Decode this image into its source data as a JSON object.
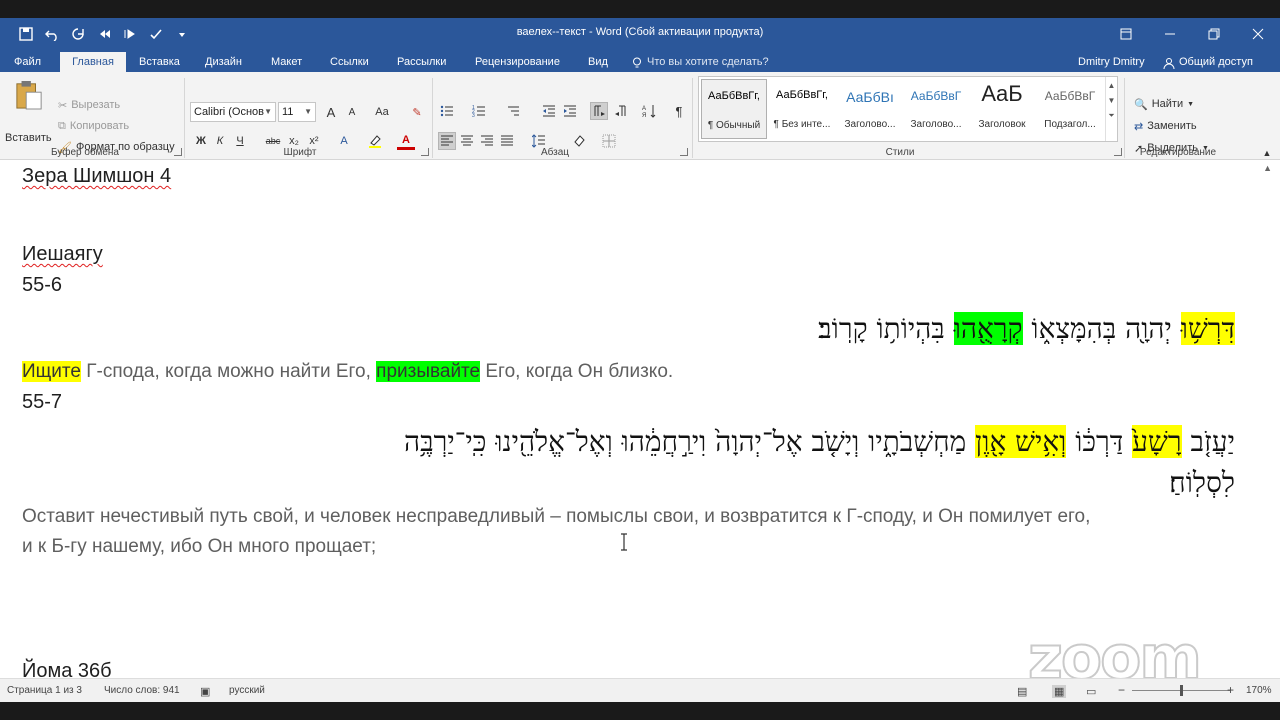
{
  "window": {
    "title": "ваелех--текст - Word (Сбой активации продукта)"
  },
  "tabs": {
    "file": "Файл",
    "items": [
      "Главная",
      "Вставка",
      "Дизайн",
      "Макет",
      "Ссылки",
      "Рассылки",
      "Рецензирование",
      "Вид"
    ],
    "tell_me": "Что вы хотите сделать?",
    "user": "Dmitry Dmitry",
    "share": "Общий доступ"
  },
  "clipboard": {
    "paste": "Вставить",
    "cut": "Вырезать",
    "copy": "Копировать",
    "format_painter": "Формат по образцу",
    "group": "Буфер обмена"
  },
  "font": {
    "name": "Calibri (Основ",
    "size": "11",
    "group": "Шрифт",
    "bold": "Ж",
    "italic": "К",
    "underline": "Ч",
    "strike": "abc",
    "sub": "x₂",
    "sup": "x²",
    "case": "Aa",
    "grow": "A",
    "shrink": "A",
    "effects": "A",
    "color": "A"
  },
  "paragraph": {
    "group": "Абзац"
  },
  "styles": {
    "group": "Стили",
    "items": [
      {
        "sample": "АаБбВвГг,",
        "name": "¶ Обычный"
      },
      {
        "sample": "АаБбВвГг,",
        "name": "¶ Без инте..."
      },
      {
        "sample": "АаБбВı",
        "name": "Заголово..."
      },
      {
        "sample": "АаБбВвГ",
        "name": "Заголово..."
      },
      {
        "sample": "AaБ",
        "name": "Заголовок"
      },
      {
        "sample": "АаБбВвГ",
        "name": "Подзагол..."
      }
    ]
  },
  "editing": {
    "group": "Редактирование",
    "find": "Найти",
    "replace": "Заменить",
    "select": "Выделить"
  },
  "document": {
    "line1": "Зера Шимшон 4",
    "line2": "Иешаягу",
    "line3": "55-6",
    "hebrew1_a": "דִּרְשׁ֥וּ",
    "hebrew1_b": " יְהוָ֖ה בְּהִמָּצְא֑וֹ ",
    "hebrew1_c": "קְרָאֻ֖הוּ",
    "hebrew1_d": " בִּהְיוֹת֥וֹ קָרֽוֹב׃",
    "ru1_a": "Ищите",
    "ru1_b": " Г-спода, когда можно найти Его, ",
    "ru1_c": "призывайте",
    "ru1_d": " Его, когда Он близко.",
    "line4": "55-7",
    "hebrew2_a": "יַעֲזֹ֤ב ",
    "hebrew2_b": "רָשָׁע֙",
    "hebrew2_c": " דַּרְכּ֔וֹ ",
    "hebrew2_d": "וְאִ֥ישׁ אָ֖וֶן",
    "hebrew2_e": " מַחְשְׁבֹתָ֑יו וְיָשֹׁ֤ב אֶל־יְהוָה֙ וִירַ֣חֲמֵ֔הוּ וְאֶל־אֱלֹהֵ֖ינוּ כִּֽי־יַרְבֶּ֥ה",
    "hebrew2_f": "לִסְלֽוֹחַ׃",
    "ru2_line1": "Оставит нечестивый путь свой, и человек несправедливый – помыслы свои, и возвратится к Г-споду, и Он помилует его,",
    "ru2_line2": "и к Б-гу нашему, ибо Он много прощает;",
    "line5": "Йома 36б"
  },
  "watermark": "zoom",
  "status": {
    "page": "Страница 1 из 3",
    "words": "Число слов: 941",
    "lang": "русский",
    "zoom_minus": "−",
    "zoom_plus": "+",
    "zoom_level": "170%"
  },
  "colors": {
    "accent": "#2b579a",
    "highlight_yellow": "#ffff00",
    "highlight_green": "#00ff00"
  }
}
